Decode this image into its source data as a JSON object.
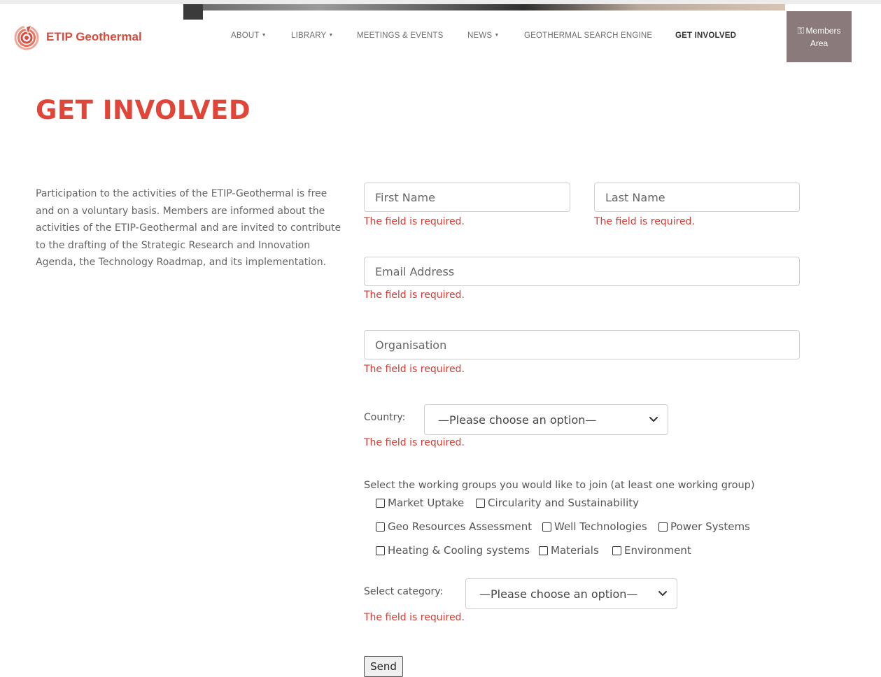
{
  "brand": {
    "name": "ETIP Geothermal"
  },
  "nav": {
    "items": [
      {
        "label": "ABOUT",
        "dropdown": true
      },
      {
        "label": "LIBRARY",
        "dropdown": true
      },
      {
        "label": "MEETINGS & EVENTS",
        "dropdown": false
      },
      {
        "label": "NEWS",
        "dropdown": true
      },
      {
        "label": "GEOTHERMAL SEARCH ENGINE",
        "dropdown": false
      },
      {
        "label": "GET INVOLVED",
        "dropdown": false,
        "active": true
      }
    ],
    "members": {
      "line1": "Members",
      "line2": "Area",
      "icon": "key-icon"
    }
  },
  "page": {
    "title": "GET INVOLVED",
    "intro": "Participation to the activities of the ETIP-Geothermal is free and on a voluntary basis. Members are informed about the activities of the ETIP-Geothermal and are invited to contribute to the drafting of the Strategic Research and Innovation Agenda, the Technology Roadmap, and its implementation."
  },
  "form": {
    "first_name": {
      "placeholder": "First Name",
      "value": ""
    },
    "last_name": {
      "placeholder": "Last Name",
      "value": ""
    },
    "email": {
      "placeholder": "Email Address",
      "value": ""
    },
    "organisation": {
      "placeholder": "Organisation",
      "value": ""
    },
    "required_error": "The field is required.",
    "country": {
      "label": "Country:",
      "selected": "—Please choose an option—"
    },
    "working_groups": {
      "title": "Select the working groups you would like to join (at least one working group)",
      "options": [
        "Market Uptake",
        "Circularity and Sustainability",
        "Geo Resources Assessment",
        "Well Technologies",
        "Power Systems",
        "Heating & Cooling systems",
        "Materials",
        "Environment"
      ]
    },
    "category": {
      "label": "Select category:",
      "selected": "—Please choose an option—"
    },
    "submit_label": "Send"
  },
  "colors": {
    "brand_red": "#e04538",
    "error_red": "#d33a32",
    "members_bg": "#8a7a7b"
  }
}
